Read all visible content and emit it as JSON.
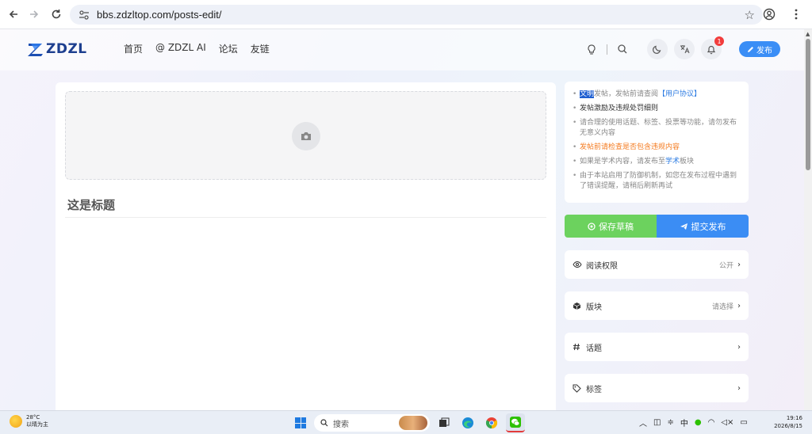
{
  "browser": {
    "url": "bbs.zdzltop.com/posts-edit/"
  },
  "site": {
    "logo_text": "ZDZL",
    "nav": [
      "首页",
      "@ ZDZL AI",
      "论坛",
      "友链"
    ],
    "notification_count": "1",
    "publish_label": "发布"
  },
  "editor": {
    "title": "这是标题"
  },
  "tips": {
    "item1_selected": "文明",
    "item1_rest": "发帖，发帖前请查阅",
    "item1_link": "【用户协议】",
    "item2": "发帖激励及违规处罚细则",
    "item3": "请合理的使用话题、标签、投票等功能，请勿发布无意义内容",
    "item4": "发帖前请检查是否包含违规内容",
    "item5_prefix": "如果是学术内容，请发布至",
    "item5_link": "学术",
    "item5_suffix": "板块",
    "item6": "由于本站启用了防御机制，如您在发布过程中遇到了错误提醒，请稍后刷新再试"
  },
  "actions": {
    "save_draft": "保存草稿",
    "submit": "提交发布"
  },
  "options": [
    {
      "label": "阅读权限",
      "value": "公开",
      "icon": "eye-icon"
    },
    {
      "label": "版块",
      "value": "请选择",
      "icon": "cube-icon"
    },
    {
      "label": "话题",
      "value": "",
      "icon": "hash-icon"
    },
    {
      "label": "标签",
      "value": "",
      "icon": "tag-icon"
    }
  ],
  "taskbar": {
    "temperature": "28°C",
    "weather": "以晴为主",
    "search_placeholder": "搜索",
    "ime": "中",
    "time": "19:16",
    "date": "2026/8/15"
  },
  "colors": {
    "accent_blue": "#3b8df4",
    "save_green": "#6cd25e",
    "warning_orange": "#f47b20",
    "badge_red": "#f23c3c"
  }
}
